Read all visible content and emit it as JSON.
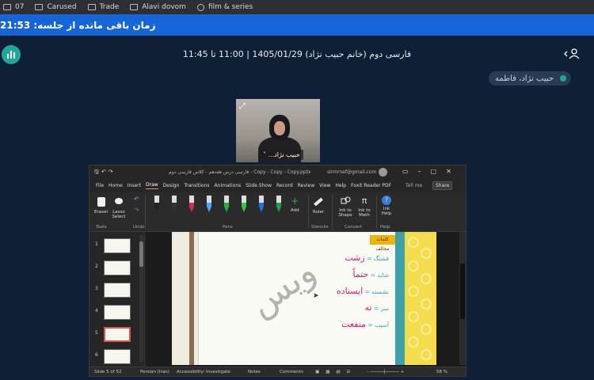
{
  "bookmarks": [
    {
      "label": "07",
      "icon": "checkbox-icon"
    },
    {
      "label": "Carused",
      "icon": "checkbox-icon"
    },
    {
      "label": "Trade",
      "icon": "checkbox-icon"
    },
    {
      "label": "Alavi dovom",
      "icon": "checkbox-icon"
    },
    {
      "label": "film & series",
      "icon": "globe-icon"
    }
  ],
  "timer": {
    "text": "زمان باقی مانده از جلسه: 21:53"
  },
  "header": {
    "title": "فارسی دوم (خانم حبیب نژاد) 1405/01/29 | 11:00 تا 11:45"
  },
  "participant_chip": {
    "label": "حبیب نژاد، فاطمه"
  },
  "webcam": {
    "name": "حبیب نژاد..."
  },
  "ppt": {
    "title_filename": "Copy - Copy - Copy.pptx - فارسی درس هفدهم - کلاس فارسی دوم",
    "title_account": "sirmrnef@gmail.com",
    "tabs": [
      "File",
      "Home",
      "Insert",
      "Draw",
      "Design",
      "Transitions",
      "Animations",
      "Slide Show",
      "Record",
      "Review",
      "View",
      "Help",
      "Foxit Reader PDF"
    ],
    "active_tab": "Draw",
    "tell_me": "Tell me",
    "share": "Share",
    "ribbon": {
      "eraser": "Eraser",
      "lasso": "Lasso Select",
      "add": "Add",
      "ruler": "Ruler",
      "ink_to_shape": "Ink to Shape",
      "ink_to_math": "Ink to Math",
      "ink_help": "Ink Help",
      "groups": [
        "Tools",
        "Undo",
        "Pens",
        "Stencils",
        "Convert",
        "Help"
      ]
    },
    "pen_colors": [
      "#222222",
      "#333333",
      "#e0245e",
      "#4aa8ff",
      "#23b04a",
      "#2ecc40",
      "#1d73e8",
      "#1fa04a"
    ],
    "thumbnails": [
      "1",
      "2",
      "3",
      "4",
      "5",
      "6"
    ],
    "selected_slide": 5,
    "slide": {
      "tag": "کلمات مخالف",
      "watermark": "ویس",
      "pairs": [
        {
          "left": "قشنگ =",
          "right": "زشت"
        },
        {
          "left": "شاید =",
          "right": "حتماً"
        },
        {
          "left": "نشسته =",
          "right": "ایستاده"
        },
        {
          "left": "سر =",
          "right": "ته"
        },
        {
          "left": "آسیب =",
          "right": "منفعت"
        }
      ]
    },
    "status": {
      "slide_count": "Slide 5 of 52",
      "language": "Persian (Iran)",
      "accessibility": "Accessibility: Investigate",
      "notes": "Notes",
      "comments": "Comments",
      "zoom": "58 %"
    }
  },
  "colors": {
    "background": "#0f1f35",
    "timer_bar": "#1565d8",
    "accent": "#1fa89a"
  }
}
